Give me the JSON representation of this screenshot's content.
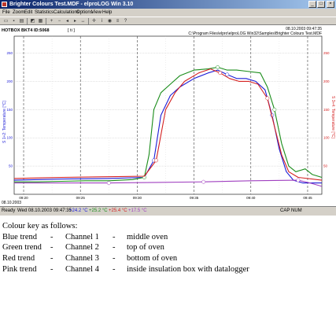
{
  "window": {
    "title": "Brighter Colours Test.MDF - elproLOG Win 3.10",
    "controls": [
      "_",
      "□",
      "×"
    ]
  },
  "menu": [
    "File",
    "Zoom",
    "Edit",
    "Statistics",
    "Calculations",
    "Options",
    "View",
    "Help"
  ],
  "toolbar_icons": [
    "open-icon",
    "save-icon",
    "print-icon",
    "chart-icon",
    "table-icon",
    "zoom-in-icon",
    "zoom-out-icon",
    "scroll-left-icon",
    "scroll-right-icon",
    "fit-icon",
    "cursor-icon",
    "info-icon",
    "eye-icon",
    "layers-icon",
    "help-icon"
  ],
  "chart_header": {
    "device": "HOTBOX BKT4  ID:5068",
    "marker": "[ ti ]",
    "date": "08.10.2003  09:47:35",
    "path": "C:\\Program Files\\elpro\\elproLOG Win32\\Samples\\Brighter Colours Test.MDF"
  },
  "chart_data": {
    "type": "line",
    "y_left_label": "S 1+2: Temperature [°C]",
    "y_right_label": "S 3+4: Temperature [°C]",
    "y_ticks": [
      50,
      100,
      150,
      200,
      250
    ],
    "ylim": [
      0,
      280
    ],
    "x_ticks": [
      "09:20",
      "09:25",
      "09:30",
      "09:35",
      "09:40",
      "09:45"
    ],
    "x_start_date": "08.10.2003",
    "series": [
      {
        "channel": 1,
        "color": "#1c1cd6",
        "points": [
          [
            0,
            25
          ],
          [
            20,
            26
          ],
          [
            40,
            27
          ],
          [
            80,
            28
          ],
          [
            110,
            30
          ],
          [
            118,
            60
          ],
          [
            124,
            140
          ],
          [
            132,
            175
          ],
          [
            140,
            190
          ],
          [
            152,
            205
          ],
          [
            164,
            215
          ],
          [
            172,
            220
          ],
          [
            180,
            212
          ],
          [
            188,
            205
          ],
          [
            196,
            205
          ],
          [
            204,
            200
          ],
          [
            212,
            185
          ],
          [
            218,
            140
          ],
          [
            224,
            80
          ],
          [
            230,
            40
          ],
          [
            236,
            25
          ],
          [
            244,
            20
          ],
          [
            260,
            20
          ]
        ]
      },
      {
        "channel": 2,
        "color": "#1a8c1a",
        "points": [
          [
            0,
            22
          ],
          [
            20,
            22
          ],
          [
            40,
            23
          ],
          [
            60,
            24
          ],
          [
            80,
            24
          ],
          [
            100,
            26
          ],
          [
            110,
            30
          ],
          [
            114,
            70
          ],
          [
            118,
            150
          ],
          [
            124,
            180
          ],
          [
            132,
            195
          ],
          [
            140,
            210
          ],
          [
            152,
            220
          ],
          [
            164,
            222
          ],
          [
            172,
            225
          ],
          [
            180,
            220
          ],
          [
            188,
            220
          ],
          [
            196,
            218
          ],
          [
            208,
            215
          ],
          [
            214,
            190
          ],
          [
            220,
            150
          ],
          [
            226,
            90
          ],
          [
            232,
            50
          ],
          [
            238,
            40
          ],
          [
            246,
            45
          ],
          [
            252,
            35
          ],
          [
            260,
            30
          ]
        ]
      },
      {
        "channel": 3,
        "color": "#d42020",
        "points": [
          [
            0,
            28
          ],
          [
            20,
            29
          ],
          [
            40,
            30
          ],
          [
            80,
            31
          ],
          [
            110,
            32
          ],
          [
            120,
            60
          ],
          [
            128,
            150
          ],
          [
            136,
            180
          ],
          [
            144,
            200
          ],
          [
            156,
            215
          ],
          [
            166,
            222
          ],
          [
            174,
            215
          ],
          [
            182,
            205
          ],
          [
            190,
            200
          ],
          [
            198,
            200
          ],
          [
            206,
            195
          ],
          [
            214,
            170
          ],
          [
            220,
            120
          ],
          [
            226,
            70
          ],
          [
            232,
            40
          ],
          [
            240,
            30
          ],
          [
            260,
            25
          ]
        ]
      },
      {
        "channel": 4,
        "color": "#a040c0",
        "points": [
          [
            0,
            20
          ],
          [
            40,
            20
          ],
          [
            80,
            20
          ],
          [
            120,
            21
          ],
          [
            160,
            22
          ],
          [
            200,
            24
          ],
          [
            240,
            25
          ],
          [
            250,
            20
          ],
          [
            260,
            14
          ]
        ]
      }
    ]
  },
  "status": {
    "left": "Ready",
    "cap": "CAP",
    "num": "NUM",
    "readout_prefix": "Wed  08.10.2003  09:47:35",
    "readouts": [
      {
        "value": "+24.2 °C",
        "color": "#1c1cd6"
      },
      {
        "value": "+25.2 °C",
        "color": "#1a8c1a"
      },
      {
        "value": "+25.4 °C",
        "color": "#d42020"
      },
      {
        "value": "+17.5 °C",
        "color": "#a040c0"
      }
    ]
  },
  "legend": {
    "heading": "Colour key as follows:",
    "rows": [
      {
        "trend": "Blue trend",
        "channel": "Channel 1",
        "desc": "middle oven"
      },
      {
        "trend": "Green trend",
        "channel": "Channel 2",
        "desc": "top of oven"
      },
      {
        "trend": "Red trend",
        "channel": "Channel 3",
        "desc": "bottom of oven"
      },
      {
        "trend": "Pink trend",
        "channel": "Channel 4",
        "desc": "inside insulation box with datalogger"
      }
    ],
    "dash": "-"
  }
}
